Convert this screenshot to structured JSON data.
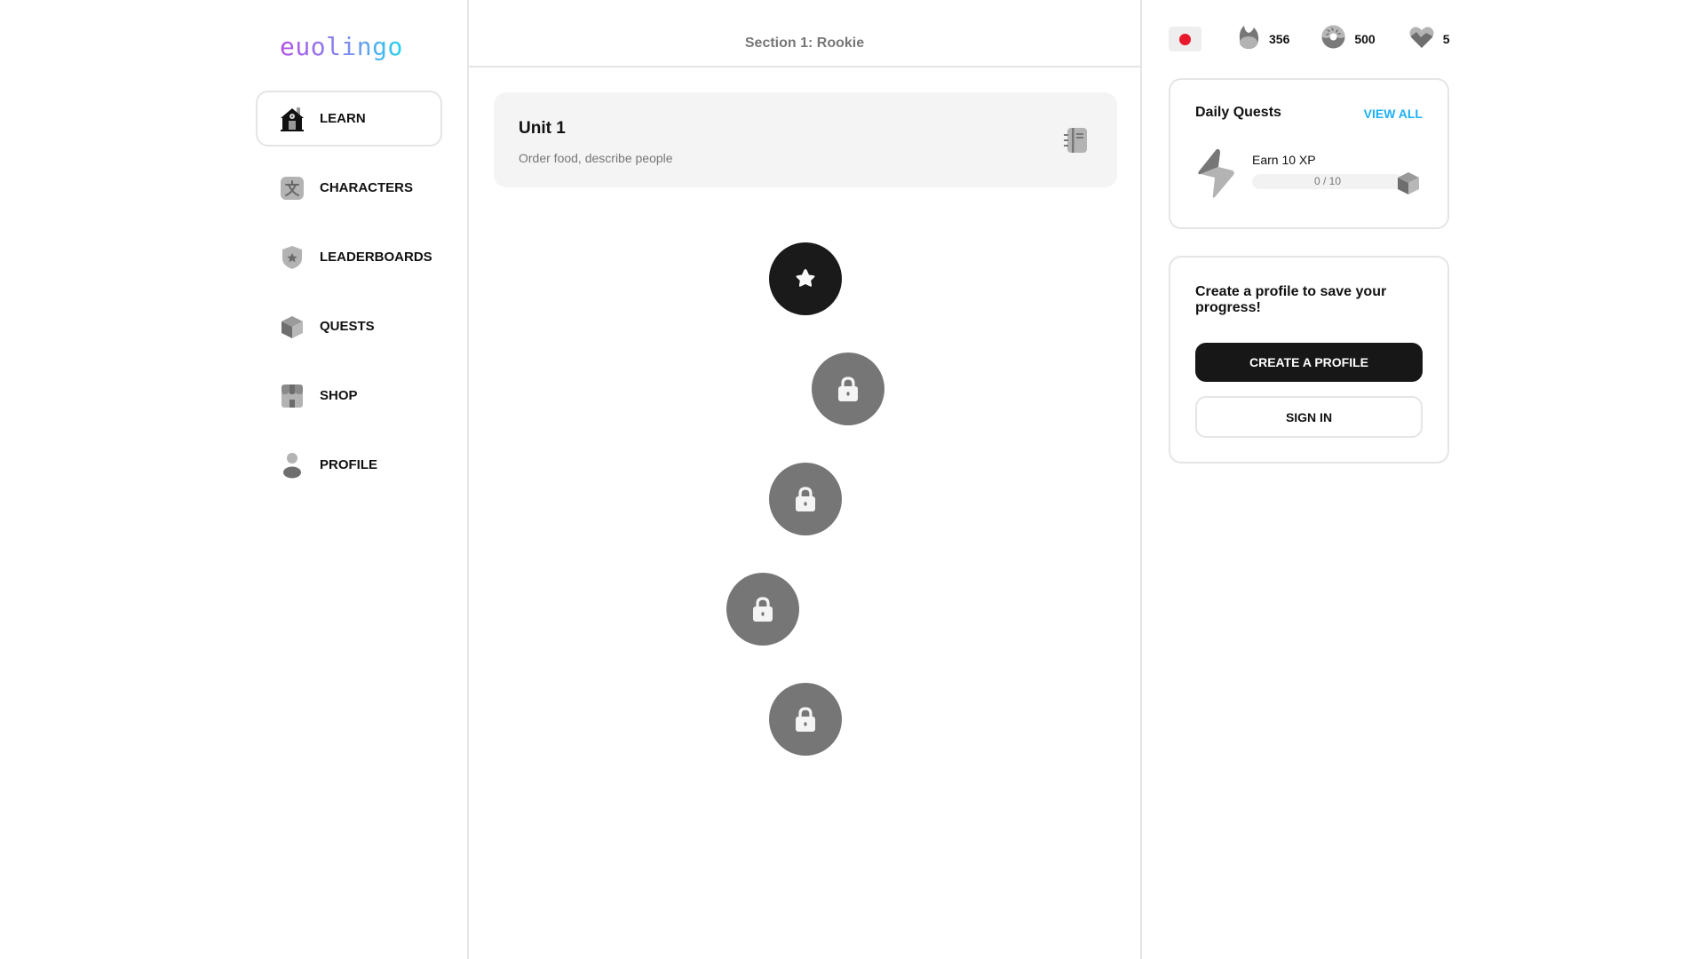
{
  "app": {
    "logo_text": "euolingo"
  },
  "sidebar": {
    "items": [
      {
        "label": "LEARN",
        "icon": "house-icon",
        "active": true
      },
      {
        "label": "CHARACTERS",
        "icon": "characters-icon",
        "active": false
      },
      {
        "label": "LEADERBOARDS",
        "icon": "shield-star-icon",
        "active": false
      },
      {
        "label": "QUESTS",
        "icon": "chest-icon",
        "active": false
      },
      {
        "label": "SHOP",
        "icon": "shop-icon",
        "active": false
      },
      {
        "label": "PROFILE",
        "icon": "user-icon",
        "active": false
      }
    ]
  },
  "main": {
    "section_title": "Section 1: Rookie",
    "unit": {
      "title": "Unit 1",
      "subtitle": "Order food, describe people",
      "guide_icon": "guidebook-icon"
    },
    "path_nodes": [
      {
        "state": "current",
        "icon": "star-icon"
      },
      {
        "state": "locked",
        "icon": "lock-icon"
      },
      {
        "state": "locked",
        "icon": "lock-icon"
      },
      {
        "state": "locked",
        "icon": "lock-icon"
      },
      {
        "state": "locked",
        "icon": "lock-icon"
      }
    ]
  },
  "right": {
    "stats": {
      "flag_icon": "japan-flag-icon",
      "streak": "356",
      "gems": "500",
      "hearts": "5"
    },
    "daily_quests": {
      "title": "Daily Quests",
      "view_all": "VIEW ALL",
      "quests": [
        {
          "label": "Earn 10 XP",
          "progress_text": "0 / 10",
          "progress": 0,
          "goal": 10
        }
      ]
    },
    "profile_prompt": {
      "title": "Create a profile to save your progress!",
      "create_button": "CREATE A PROFILE",
      "sign_in_button": "SIGN IN"
    }
  },
  "colors": {
    "flag_red": "#e8192c",
    "accent_link": "#1cb0f6",
    "node_current": "#1a1a1a",
    "node_locked": "#767676",
    "primary_button": "#171717"
  }
}
